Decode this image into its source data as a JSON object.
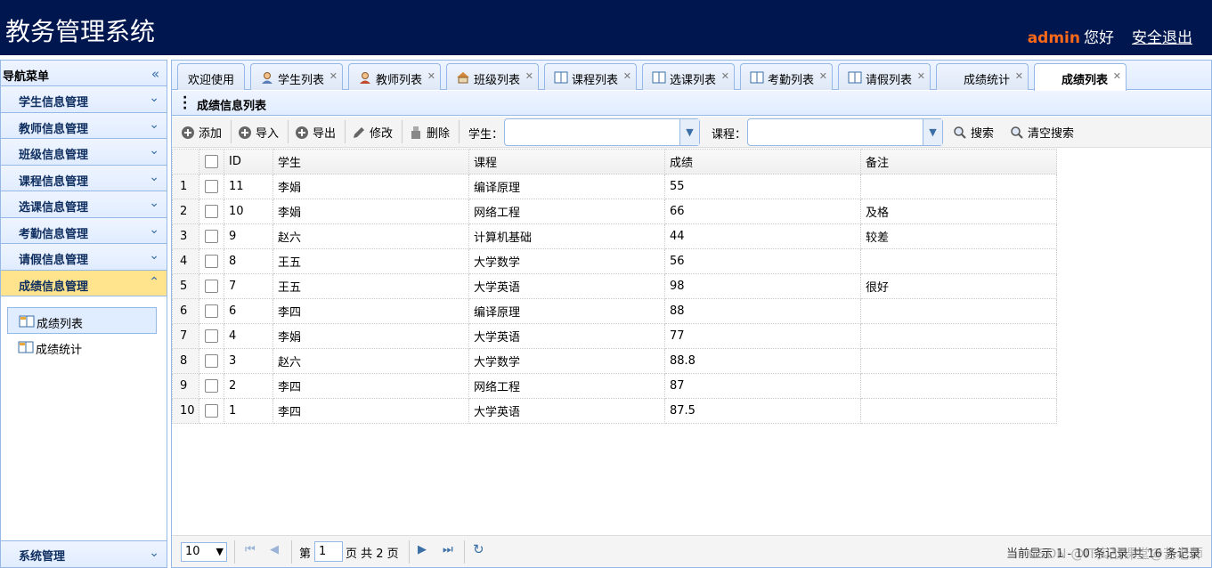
{
  "header": {
    "title": "教务管理系统",
    "user": "admin",
    "greeting": "您好",
    "logout": "安全退出"
  },
  "nav": {
    "title": "导航菜单",
    "sections": [
      {
        "label": "学生信息管理"
      },
      {
        "label": "教师信息管理"
      },
      {
        "label": "班级信息管理"
      },
      {
        "label": "课程信息管理"
      },
      {
        "label": "选课信息管理"
      },
      {
        "label": "考勤信息管理"
      },
      {
        "label": "请假信息管理"
      },
      {
        "label": "成绩信息管理"
      }
    ],
    "active_section": "成绩信息管理",
    "sub_items": [
      {
        "label": "成绩列表",
        "selected": true
      },
      {
        "label": "成绩统计",
        "selected": false
      }
    ],
    "bottom_section": "系统管理"
  },
  "tabs": [
    {
      "label": "欢迎使用",
      "closable": false,
      "icon": ""
    },
    {
      "label": "学生列表",
      "closable": true,
      "icon": "student-icon"
    },
    {
      "label": "教师列表",
      "closable": true,
      "icon": "teacher-icon"
    },
    {
      "label": "班级列表",
      "closable": true,
      "icon": "house-icon"
    },
    {
      "label": "课程列表",
      "closable": true,
      "icon": "book-icon"
    },
    {
      "label": "选课列表",
      "closable": true,
      "icon": "book-icon"
    },
    {
      "label": "考勤列表",
      "closable": true,
      "icon": "book-icon"
    },
    {
      "label": "请假列表",
      "closable": true,
      "icon": "book-icon"
    },
    {
      "label": "成绩统计",
      "closable": true,
      "icon": ""
    },
    {
      "label": "成绩列表",
      "closable": true,
      "icon": "",
      "active": true
    }
  ],
  "panel": {
    "title": "成绩信息列表"
  },
  "toolbar": {
    "add": "添加",
    "import": "导入",
    "export": "导出",
    "edit": "修改",
    "delete": "删除",
    "student_label": "学生：",
    "student_value": "",
    "course_label": "课程：",
    "course_value": "",
    "search": "搜索",
    "clear": "清空搜索"
  },
  "grid": {
    "columns": [
      "ID",
      "学生",
      "课程",
      "成绩",
      "备注"
    ],
    "rows": [
      {
        "n": "1",
        "id": "11",
        "student": "李娟",
        "course": "编译原理",
        "score": "55",
        "note": ""
      },
      {
        "n": "2",
        "id": "10",
        "student": "李娟",
        "course": "网络工程",
        "score": "66",
        "note": "及格"
      },
      {
        "n": "3",
        "id": "9",
        "student": "赵六",
        "course": "计算机基础",
        "score": "44",
        "note": "较差"
      },
      {
        "n": "4",
        "id": "8",
        "student": "王五",
        "course": "大学数学",
        "score": "56",
        "note": ""
      },
      {
        "n": "5",
        "id": "7",
        "student": "王五",
        "course": "大学英语",
        "score": "98",
        "note": "很好"
      },
      {
        "n": "6",
        "id": "6",
        "student": "李四",
        "course": "编译原理",
        "score": "88",
        "note": ""
      },
      {
        "n": "7",
        "id": "4",
        "student": "李娟",
        "course": "大学英语",
        "score": "77",
        "note": ""
      },
      {
        "n": "8",
        "id": "3",
        "student": "赵六",
        "course": "大学数学",
        "score": "88.8",
        "note": ""
      },
      {
        "n": "9",
        "id": "2",
        "student": "李四",
        "course": "网络工程",
        "score": "87",
        "note": ""
      },
      {
        "n": "10",
        "id": "1",
        "student": "李四",
        "course": "大学英语",
        "score": "87.5",
        "note": ""
      }
    ]
  },
  "pager": {
    "page_size": "10",
    "page_prefix": "第",
    "page": "1",
    "page_suffix": "页 共 2 页",
    "info": "当前显示 1 - 10 条记录 共 16 条记录"
  },
  "watermark": "CSDN @IT实战课堂@苦老师",
  "colors": {
    "header_bg": "#00164f",
    "username": "#ff6a1a",
    "active_section": "#ffe48d",
    "border": "#95b8e7"
  }
}
